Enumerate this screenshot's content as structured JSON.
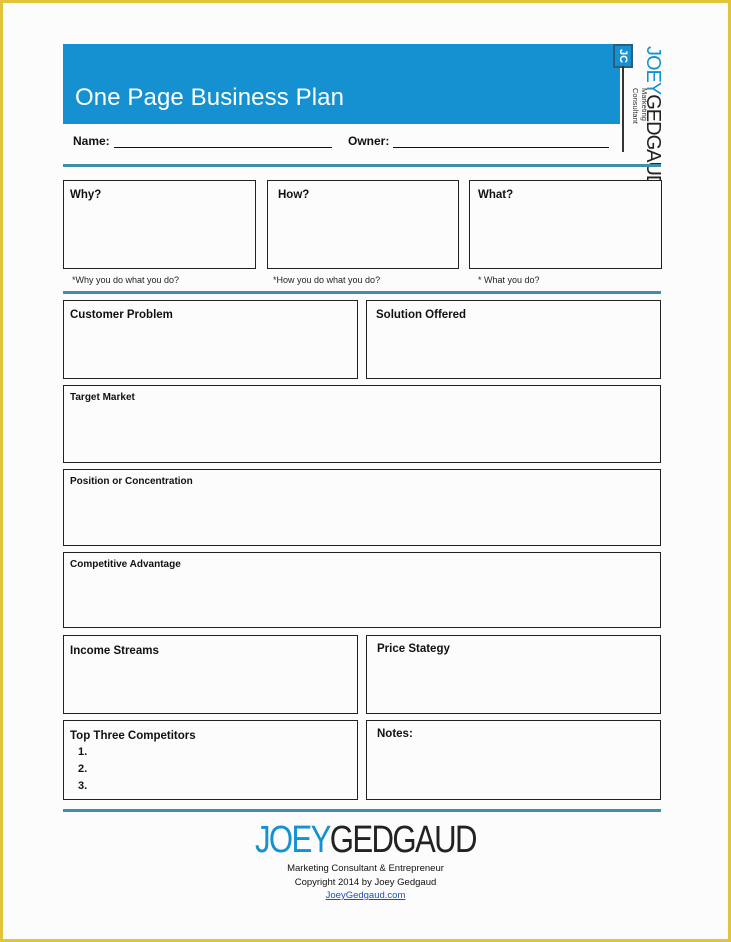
{
  "header": {
    "title": "One Page Business Plan",
    "name_label": "Name:",
    "owner_label": "Owner:"
  },
  "brand": {
    "initials": "JC",
    "name_part1": "JOEY",
    "name_part2": "GEDGAUD",
    "subtitle": "Marketing Consultant",
    "accent_color": "#1591d1",
    "rule_color": "#3f8fab"
  },
  "top_boxes": [
    {
      "label": "Why?",
      "hint": "*Why you do what you do?"
    },
    {
      "label": "How?",
      "hint": "*How you do what you do?"
    },
    {
      "label": "What?",
      "hint": "* What you do?"
    }
  ],
  "sections": {
    "customer_problem": "Customer Problem",
    "solution_offered": "Solution Offered",
    "target_market": "Target Market",
    "position": "Position or Concentration",
    "competitive_advantage": "Competitive Advantage",
    "income_streams": "Income Streams",
    "price_strategy": "Price Stategy",
    "top_competitors": "Top Three Competitors",
    "notes": "Notes:"
  },
  "competitors": [
    "1.",
    "2.",
    "3."
  ],
  "footer": {
    "brand_part1": "JOEY",
    "brand_part2": "GEDGAUD",
    "tagline": "Marketing Consultant & Entrepreneur",
    "copyright": "Copyright 2014 by Joey Gedgaud",
    "link": "JoeyGedgaud.com"
  }
}
